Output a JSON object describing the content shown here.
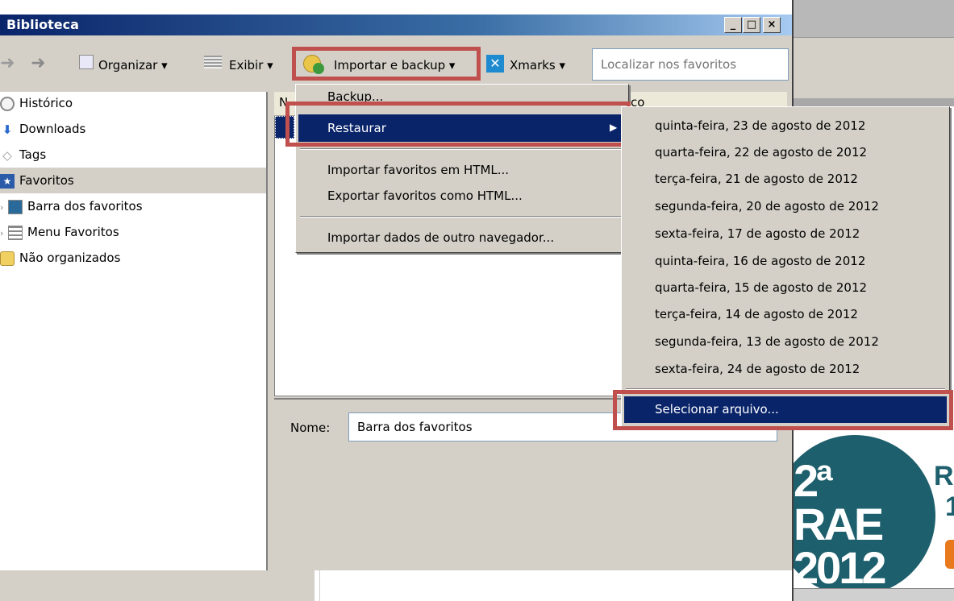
{
  "window": {
    "title": "Biblioteca",
    "buttons": [
      "_",
      "□",
      "×"
    ]
  },
  "toolbar": {
    "organizar": "Organizar ▾",
    "exibir": "Exibir ▾",
    "importar": "Importar e backup ▾",
    "xmarks": "Xmarks ▾",
    "search_placeholder": "Localizar nos favoritos"
  },
  "sidebar": {
    "items": [
      {
        "label": "Histórico",
        "icon": "clock-icon"
      },
      {
        "label": "Downloads",
        "icon": "download-arrow-icon"
      },
      {
        "label": "Tags",
        "icon": "tag-icon"
      },
      {
        "label": "Favoritos",
        "icon": "star-icon"
      },
      {
        "label": "Barra dos favoritos",
        "icon": "bookmarks-toolbar-icon"
      },
      {
        "label": "Menu Favoritos",
        "icon": "bookmarks-menu-icon"
      },
      {
        "label": "Não organizados",
        "icon": "unsorted-bookmarks-icon"
      }
    ]
  },
  "content": {
    "col_n": "N",
    "col_co": "co",
    "nome_label": "Nome:",
    "nome_value": "Barra dos favoritos"
  },
  "menu": {
    "backup": "Backup...",
    "restaurar": "Restaurar",
    "importar_html": "Importar favoritos em HTML...",
    "exportar_html": "Exportar favoritos como HTML...",
    "importar_dados": "Importar dados de outro navegador..."
  },
  "submenu": {
    "dates": [
      "quinta-feira, 23 de agosto de 2012",
      "quarta-feira, 22 de agosto de 2012",
      "terça-feira, 21 de agosto de 2012",
      "segunda-feira, 20 de agosto de 2012",
      "sexta-feira, 17 de agosto de 2012",
      "quinta-feira, 16 de agosto de 2012",
      "quarta-feira, 15 de agosto de 2012",
      "terça-feira, 14 de agosto de 2012",
      "segunda-feira, 13 de agosto de 2012",
      "sexta-feira, 24 de agosto de 2012"
    ],
    "select_file": "Selecionar arquivo..."
  },
  "background": {
    "banner_line1": "2ª RAE",
    "banner_line2": "2012",
    "side_r": "Re",
    "side_t": "1"
  },
  "colors": {
    "highlight": "#c0504d",
    "menu_selected": "#0a246a",
    "banner": "#1d5f6c"
  }
}
